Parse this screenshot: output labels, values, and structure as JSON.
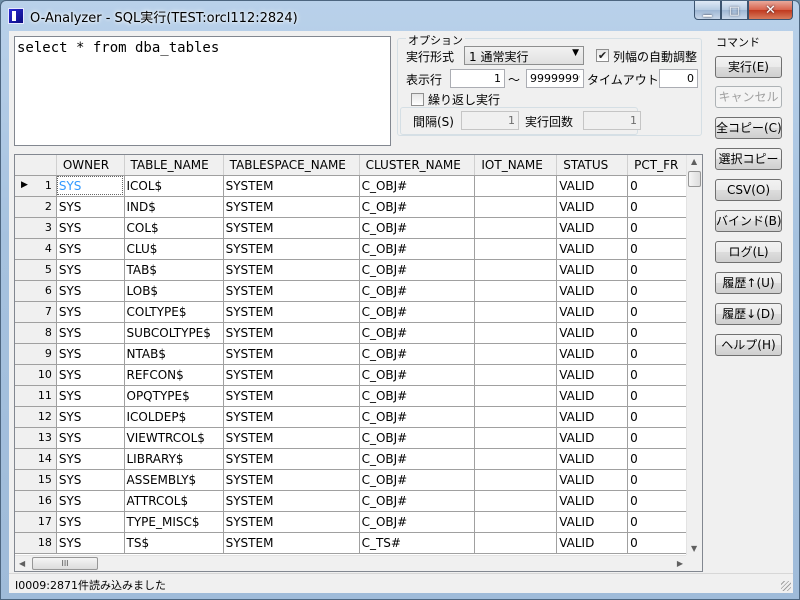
{
  "window": {
    "title": "O-Analyzer - SQL実行(TEST:orcl112:2824)",
    "min_glyph": "▁",
    "max_glyph": "□",
    "close_glyph": "✕"
  },
  "sql": {
    "text": "select * from dba_tables"
  },
  "options": {
    "legend": "オプション",
    "exec_mode_label": "実行形式",
    "exec_mode_value": "1 通常実行",
    "auto_width_label": "列幅の自動調整",
    "auto_width_checked": true,
    "display_rows_label": "表示行",
    "rows_from": "1",
    "tilde": "～",
    "rows_to": "99999999",
    "timeout_label": "タイムアウト(S)",
    "timeout_value": "0",
    "repeat_label": "繰り返し実行",
    "repeat_checked": false,
    "interval_label": "間隔(S)",
    "interval_value": "1",
    "exec_count_label": "実行回数",
    "exec_count_value": "1"
  },
  "commands": {
    "legend": "コマンド",
    "buttons": [
      {
        "label": "実行(E)",
        "enabled": true
      },
      {
        "label": "キャンセル",
        "enabled": false
      },
      {
        "label": "全コピー(C)",
        "enabled": true
      },
      {
        "label": "選択コピー",
        "enabled": true
      },
      {
        "label": "CSV(O)",
        "enabled": true
      },
      {
        "label": "バインド(B)",
        "enabled": true
      },
      {
        "label": "ログ(L)",
        "enabled": true
      },
      {
        "label": "履歴↑(U)",
        "enabled": true
      },
      {
        "label": "履歴↓(D)",
        "enabled": true
      },
      {
        "label": "ヘルプ(H)",
        "enabled": true
      }
    ]
  },
  "grid": {
    "columns": [
      "OWNER",
      "TABLE_NAME",
      "TABLESPACE_NAME",
      "CLUSTER_NAME",
      "IOT_NAME",
      "STATUS",
      "PCT_FR"
    ],
    "rows": [
      {
        "n": "1",
        "cells": [
          "SYS",
          "ICOL$",
          "SYSTEM",
          "C_OBJ#",
          "",
          "VALID",
          "0"
        ]
      },
      {
        "n": "2",
        "cells": [
          "SYS",
          "IND$",
          "SYSTEM",
          "C_OBJ#",
          "",
          "VALID",
          "0"
        ]
      },
      {
        "n": "3",
        "cells": [
          "SYS",
          "COL$",
          "SYSTEM",
          "C_OBJ#",
          "",
          "VALID",
          "0"
        ]
      },
      {
        "n": "4",
        "cells": [
          "SYS",
          "CLU$",
          "SYSTEM",
          "C_OBJ#",
          "",
          "VALID",
          "0"
        ]
      },
      {
        "n": "5",
        "cells": [
          "SYS",
          "TAB$",
          "SYSTEM",
          "C_OBJ#",
          "",
          "VALID",
          "0"
        ]
      },
      {
        "n": "6",
        "cells": [
          "SYS",
          "LOB$",
          "SYSTEM",
          "C_OBJ#",
          "",
          "VALID",
          "0"
        ]
      },
      {
        "n": "7",
        "cells": [
          "SYS",
          "COLTYPE$",
          "SYSTEM",
          "C_OBJ#",
          "",
          "VALID",
          "0"
        ]
      },
      {
        "n": "8",
        "cells": [
          "SYS",
          "SUBCOLTYPE$",
          "SYSTEM",
          "C_OBJ#",
          "",
          "VALID",
          "0"
        ]
      },
      {
        "n": "9",
        "cells": [
          "SYS",
          "NTAB$",
          "SYSTEM",
          "C_OBJ#",
          "",
          "VALID",
          "0"
        ]
      },
      {
        "n": "10",
        "cells": [
          "SYS",
          "REFCON$",
          "SYSTEM",
          "C_OBJ#",
          "",
          "VALID",
          "0"
        ]
      },
      {
        "n": "11",
        "cells": [
          "SYS",
          "OPQTYPE$",
          "SYSTEM",
          "C_OBJ#",
          "",
          "VALID",
          "0"
        ]
      },
      {
        "n": "12",
        "cells": [
          "SYS",
          "ICOLDEP$",
          "SYSTEM",
          "C_OBJ#",
          "",
          "VALID",
          "0"
        ]
      },
      {
        "n": "13",
        "cells": [
          "SYS",
          "VIEWTRCOL$",
          "SYSTEM",
          "C_OBJ#",
          "",
          "VALID",
          "0"
        ]
      },
      {
        "n": "14",
        "cells": [
          "SYS",
          "LIBRARY$",
          "SYSTEM",
          "C_OBJ#",
          "",
          "VALID",
          "0"
        ]
      },
      {
        "n": "15",
        "cells": [
          "SYS",
          "ASSEMBLY$",
          "SYSTEM",
          "C_OBJ#",
          "",
          "VALID",
          "0"
        ]
      },
      {
        "n": "16",
        "cells": [
          "SYS",
          "ATTRCOL$",
          "SYSTEM",
          "C_OBJ#",
          "",
          "VALID",
          "0"
        ]
      },
      {
        "n": "17",
        "cells": [
          "SYS",
          "TYPE_MISC$",
          "SYSTEM",
          "C_OBJ#",
          "",
          "VALID",
          "0"
        ]
      },
      {
        "n": "18",
        "cells": [
          "SYS",
          "TS$",
          "SYSTEM",
          "C_TS#",
          "",
          "VALID",
          "0"
        ]
      }
    ],
    "current_row_marker": "▶",
    "hthumb_grip": "III"
  },
  "status": {
    "message": "I0009:2871件読み込みました"
  }
}
